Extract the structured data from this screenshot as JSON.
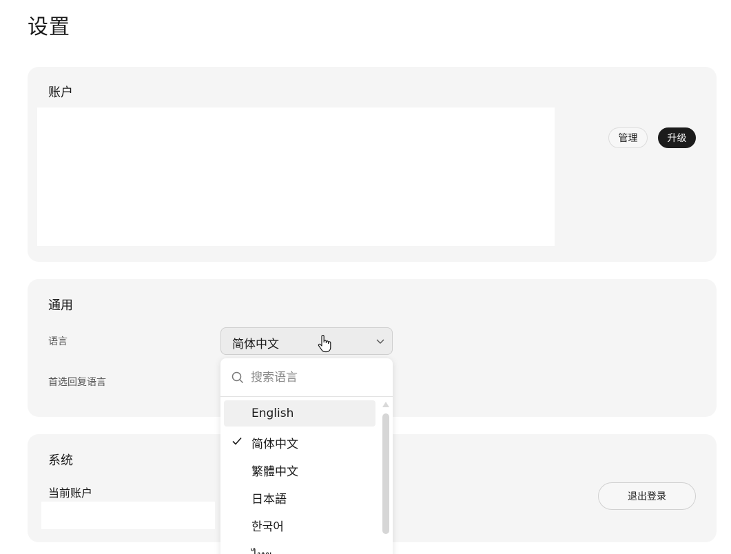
{
  "page": {
    "title": "设置"
  },
  "account": {
    "title": "账户",
    "manage_label": "管理",
    "upgrade_label": "升级"
  },
  "general": {
    "title": "通用",
    "language_label": "语言",
    "language_value": "简体中文",
    "reply_language_label": "首选回复语言"
  },
  "system": {
    "title": "系统",
    "current_account_label": "当前账户",
    "logout_label": "退出登录"
  },
  "dropdown": {
    "search_placeholder": "搜索语言",
    "options": [
      {
        "label": "English",
        "selected": false,
        "hovered": true
      },
      {
        "label": "简体中文",
        "selected": true,
        "hovered": false
      },
      {
        "label": "繁體中文",
        "selected": false,
        "hovered": false
      },
      {
        "label": "日本語",
        "selected": false,
        "hovered": false
      },
      {
        "label": "한국어",
        "selected": false,
        "hovered": false
      },
      {
        "label": "ไทย",
        "selected": false,
        "hovered": false
      }
    ]
  },
  "icons": {
    "search": "search-icon",
    "check": "check-icon",
    "chevron": "chevron-down-icon",
    "cursor": "hand-cursor-icon",
    "scroll": "scroll-up-arrow-icon"
  },
  "colors": {
    "card_bg": "#f5f5f5",
    "upgrade_bg": "#1c1c1c",
    "hover_bg": "#f0f0f0"
  }
}
